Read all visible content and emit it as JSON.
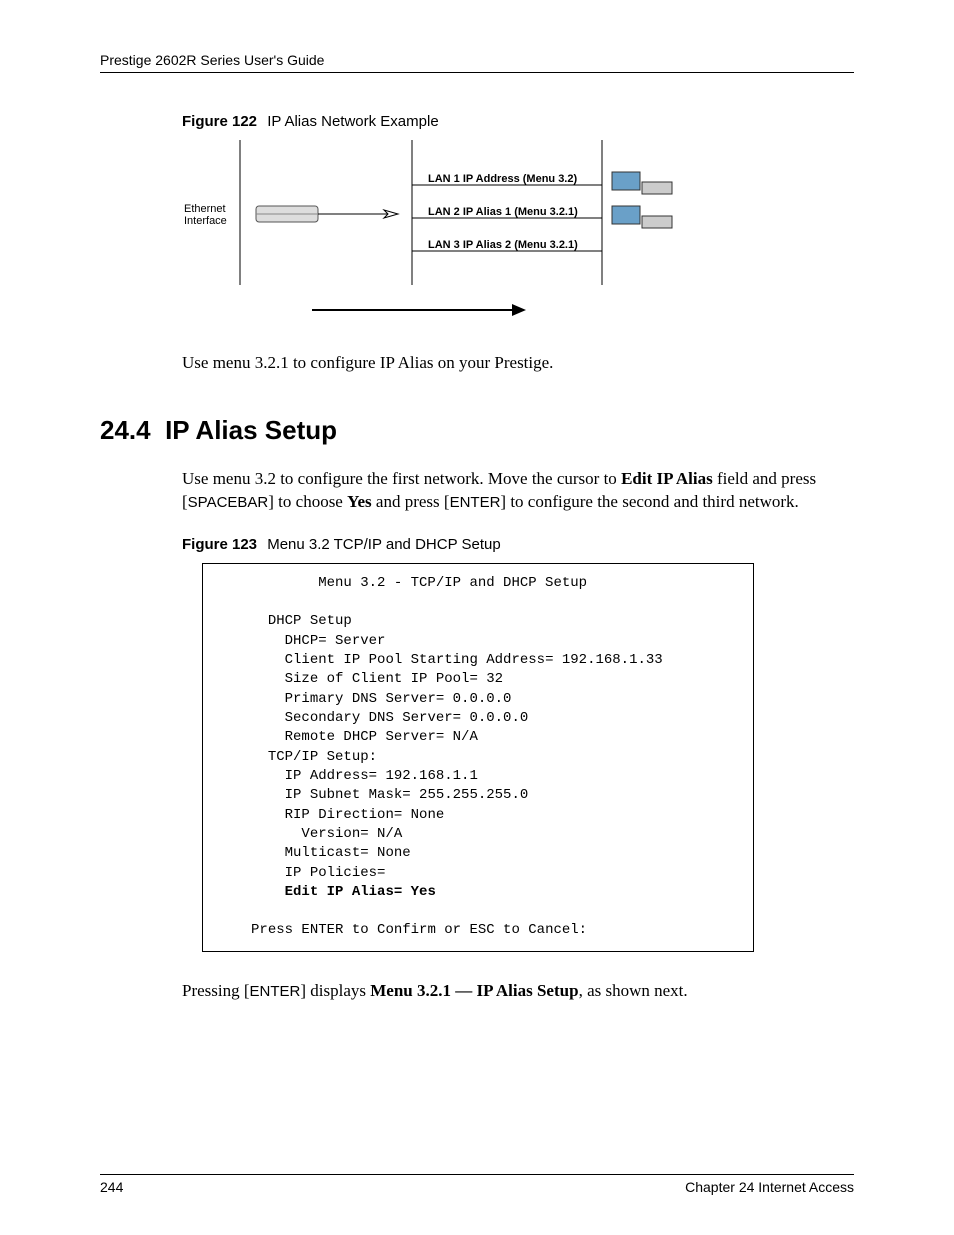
{
  "header": {
    "running_head": "Prestige 2602R Series User's Guide"
  },
  "figure122": {
    "label": "Figure 122",
    "title": "IP Alias Network Example",
    "diagram": {
      "left_label_top": "Ethernet",
      "left_label_bottom": "Interface",
      "lan1": "LAN 1 IP Address (Menu 3.2)",
      "lan2": "LAN 2 IP Alias 1 (Menu 3.2.1)",
      "lan3": "LAN 3 IP Alias 2 (Menu 3.2.1)"
    }
  },
  "para1": {
    "text": "Use menu 3.2.1 to configure IP Alias on your Prestige."
  },
  "section": {
    "num": "24.4",
    "title": "IP Alias Setup"
  },
  "para2": {
    "t1": "Use menu 3.2 to configure the first network. Move the cursor to ",
    "bold1": "Edit IP Alias",
    "t2": " field and press [",
    "key1": "SPACEBAR",
    "t3": "] to choose ",
    "bold2": "Yes",
    "t4": " and press [",
    "key2": "ENTER",
    "t5": "] to configure the second and third network."
  },
  "figure123": {
    "label": "Figure 123",
    "title": "Menu 3.2 TCP/IP and DHCP Setup"
  },
  "menu": {
    "title": "Menu 3.2 - TCP/IP and DHCP Setup",
    "dhcp_header": "DHCP Setup",
    "dhcp_mode": "DHCP= Server",
    "pool_start": "Client IP Pool Starting Address= 192.168.1.33",
    "pool_size": "Size of Client IP Pool= 32",
    "primary_dns": "Primary DNS Server= 0.0.0.0",
    "secondary_dns": "Secondary DNS Server= 0.0.0.0",
    "remote_dhcp": "Remote DHCP Server= N/A",
    "tcpip_header": "TCP/IP Setup:",
    "ip_address": "IP Address= 192.168.1.1",
    "subnet": "IP Subnet Mask= 255.255.255.0",
    "rip_dir": "RIP Direction= None",
    "version": "Version= N/A",
    "multicast": "Multicast= None",
    "ip_policies": "IP Policies=",
    "edit_alias": "Edit IP Alias= Yes",
    "prompt": "Press ENTER to Confirm or ESC to Cancel:"
  },
  "para3": {
    "t1": "Pressing [",
    "key1": "ENTER",
    "t2": "] displays ",
    "bold1": "Menu 3.2.1 — IP Alias Setup",
    "t3": ", as shown next."
  },
  "footer": {
    "page": "244",
    "chapter": "Chapter 24 Internet Access"
  },
  "chart_data": {
    "type": "table",
    "title": "Menu 3.2 TCP/IP and DHCP Setup values",
    "rows": [
      {
        "field": "DHCP",
        "value": "Server"
      },
      {
        "field": "Client IP Pool Starting Address",
        "value": "192.168.1.33"
      },
      {
        "field": "Size of Client IP Pool",
        "value": "32"
      },
      {
        "field": "Primary DNS Server",
        "value": "0.0.0.0"
      },
      {
        "field": "Secondary DNS Server",
        "value": "0.0.0.0"
      },
      {
        "field": "Remote DHCP Server",
        "value": "N/A"
      },
      {
        "field": "IP Address",
        "value": "192.168.1.1"
      },
      {
        "field": "IP Subnet Mask",
        "value": "255.255.255.0"
      },
      {
        "field": "RIP Direction",
        "value": "None"
      },
      {
        "field": "Version",
        "value": "N/A"
      },
      {
        "field": "Multicast",
        "value": "None"
      },
      {
        "field": "IP Policies",
        "value": ""
      },
      {
        "field": "Edit IP Alias",
        "value": "Yes"
      }
    ]
  }
}
